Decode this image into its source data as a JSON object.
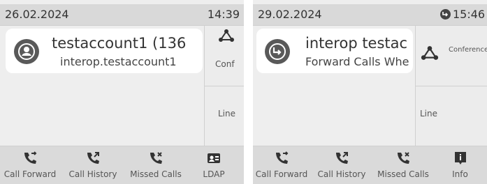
{
  "screens": [
    {
      "status": {
        "date": "26.02.2024",
        "time": "14:39"
      },
      "card": {
        "name": "testaccount1 (136",
        "sub": "interop.testaccount1"
      },
      "side": {
        "conf": "Conf",
        "line": "Line"
      },
      "softkeys": [
        {
          "label": "Call Forward",
          "icon": "call-forward-icon"
        },
        {
          "label": "Call History",
          "icon": "call-history-icon"
        },
        {
          "label": "Missed Calls",
          "icon": "missed-calls-icon"
        },
        {
          "label": "LDAP",
          "icon": "ldap-icon"
        }
      ]
    },
    {
      "status": {
        "date": "29.02.2024",
        "time": "15:46",
        "status_icon": "call-forward-status-icon"
      },
      "card": {
        "name": "interop testac",
        "sub": "Forward Calls Whe"
      },
      "side": {
        "conf": "Conference",
        "line": "Line"
      },
      "softkeys": [
        {
          "label": "Call Forward",
          "icon": "call-forward-icon"
        },
        {
          "label": "Call History",
          "icon": "call-history-icon"
        },
        {
          "label": "Missed Calls",
          "icon": "missed-calls-icon"
        },
        {
          "label": "Info",
          "icon": "info-icon"
        }
      ]
    }
  ]
}
